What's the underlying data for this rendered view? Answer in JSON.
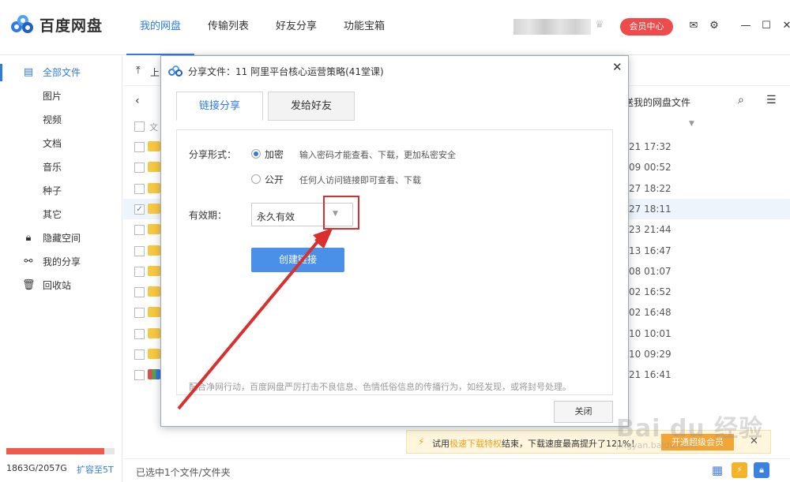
{
  "app": {
    "title": "百度网盘"
  },
  "nav": [
    "我的网盘",
    "传输列表",
    "好友分享",
    "功能宝箱"
  ],
  "header": {
    "vip_label": "会员中心"
  },
  "sidebar": {
    "items": [
      {
        "label": "全部文件",
        "icon": "document-icon"
      },
      {
        "label": "图片"
      },
      {
        "label": "视频"
      },
      {
        "label": "文档"
      },
      {
        "label": "音乐"
      },
      {
        "label": "种子"
      },
      {
        "label": "其它"
      },
      {
        "label": "隐藏空间",
        "icon": "lock-icon"
      },
      {
        "label": "我的分享",
        "icon": "share-icon"
      },
      {
        "label": "回收站",
        "icon": "trash-icon"
      }
    ],
    "quota": {
      "used_fraction": 0.905,
      "text": "1863G/2057G",
      "expand_label": "扩容至5T"
    }
  },
  "main": {
    "upload_label": "上",
    "path_right": "送我的网盘文件",
    "header_label": "文",
    "rows": [
      {
        "time": "21 17:32",
        "checked": false,
        "type": "folder"
      },
      {
        "time": "09 00:52",
        "checked": false,
        "type": "folder"
      },
      {
        "time": "27 18:22",
        "checked": false,
        "type": "folder"
      },
      {
        "time": "27 18:11",
        "checked": true,
        "type": "folder"
      },
      {
        "time": "23 21:44",
        "checked": false,
        "type": "folder"
      },
      {
        "time": "13 16:47",
        "checked": false,
        "type": "folder"
      },
      {
        "time": "08 01:07",
        "checked": false,
        "type": "folder"
      },
      {
        "time": "02 16:52",
        "checked": false,
        "type": "folder"
      },
      {
        "time": "02 16:48",
        "checked": false,
        "type": "folder"
      },
      {
        "time": "10 10:01",
        "checked": false,
        "type": "folder"
      },
      {
        "time": "10 09:29",
        "checked": false,
        "type": "folder"
      },
      {
        "time": "21 16:41",
        "checked": false,
        "type": "rar"
      }
    ],
    "status": "已选中1个文件/文件夹"
  },
  "tip": {
    "prefix": "试用",
    "highlight": "极速下载特权",
    "suffix": "结束，下载速度最高提升了121%！",
    "button": "开通超级会员"
  },
  "modal": {
    "title": "分享文件：11 阿里平台核心运营策略(41堂课)",
    "tabs": [
      "链接分享",
      "发给好友"
    ],
    "share_form_label": "分享形式：",
    "options": [
      {
        "label": "加密",
        "desc": "输入密码才能查看、下载，更加私密安全",
        "selected": true
      },
      {
        "label": "公开",
        "desc": "任何人访问链接即可查看、下载",
        "selected": false
      }
    ],
    "validity_label": "有效期：",
    "validity_value": "永久有效",
    "create_label": "创建链接",
    "notice": "配合净网行动，百度网盘严厉打击不良信息、色情低俗信息的传播行为，如经发现，或将封号处理。",
    "close_label": "关闭"
  },
  "watermark": {
    "text": "Bai du 经验",
    "sub": "jingyan.baidu.com"
  },
  "colors": {
    "accent": "#2f7be6",
    "vip": "#f04b4b",
    "annotation": "#d9302f",
    "tip_bg": "#fff6dd"
  }
}
